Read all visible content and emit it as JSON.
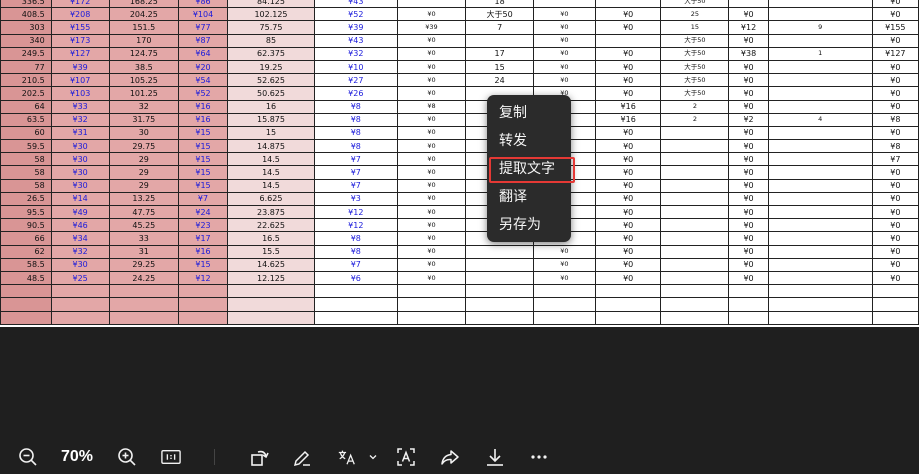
{
  "spreadsheet": {
    "rows": [
      [
        "336.5",
        "¥172",
        "168.25",
        "¥86",
        "84.125",
        "¥43",
        "",
        "18",
        "",
        "",
        "大于50",
        "",
        "",
        "¥0"
      ],
      [
        "408.5",
        "¥208",
        "204.25",
        "¥104",
        "102.125",
        "¥52",
        "¥0",
        "大于50",
        "¥0",
        "¥0",
        "25",
        "¥0",
        "",
        "¥0"
      ],
      [
        "303",
        "¥155",
        "151.5",
        "¥77",
        "75.75",
        "¥39",
        "¥39",
        "7",
        "¥0",
        "¥0",
        "15",
        "¥12",
        "9",
        "¥155"
      ],
      [
        "340",
        "¥173",
        "170",
        "¥87",
        "85",
        "¥43",
        "¥0",
        "",
        "¥0",
        "",
        "大于50",
        "¥0",
        "",
        "¥0"
      ],
      [
        "249.5",
        "¥127",
        "124.75",
        "¥64",
        "62.375",
        "¥32",
        "¥0",
        "17",
        "¥0",
        "¥0",
        "大于50",
        "¥38",
        "1",
        "¥127"
      ],
      [
        "77",
        "¥39",
        "38.5",
        "¥20",
        "19.25",
        "¥10",
        "¥0",
        "15",
        "¥0",
        "¥0",
        "大于50",
        "¥0",
        "",
        "¥0"
      ],
      [
        "210.5",
        "¥107",
        "105.25",
        "¥54",
        "52.625",
        "¥27",
        "¥0",
        "24",
        "¥0",
        "¥0",
        "大于50",
        "¥0",
        "",
        "¥0"
      ],
      [
        "202.5",
        "¥103",
        "101.25",
        "¥52",
        "50.625",
        "¥26",
        "¥0",
        "",
        "¥0",
        "¥0",
        "大于50",
        "¥0",
        "",
        "¥0"
      ],
      [
        "64",
        "¥33",
        "32",
        "¥16",
        "16",
        "¥8",
        "¥8",
        "",
        "",
        "¥16",
        "2",
        "¥0",
        "",
        "¥0"
      ],
      [
        "63.5",
        "¥32",
        "31.75",
        "¥16",
        "15.875",
        "¥8",
        "¥0",
        "",
        "",
        "¥16",
        "2",
        "¥2",
        "4",
        "¥8"
      ],
      [
        "60",
        "¥31",
        "30",
        "¥15",
        "15",
        "¥8",
        "¥0",
        "",
        "",
        "¥0",
        "",
        "¥0",
        "",
        "¥0"
      ],
      [
        "59.5",
        "¥30",
        "29.75",
        "¥15",
        "14.875",
        "¥8",
        "¥0",
        "",
        "",
        "¥0",
        "",
        "¥0",
        "",
        "¥8"
      ],
      [
        "58",
        "¥30",
        "29",
        "¥15",
        "14.5",
        "¥7",
        "¥0",
        "",
        "",
        "¥0",
        "",
        "¥0",
        "",
        "¥7"
      ],
      [
        "58",
        "¥30",
        "29",
        "¥15",
        "14.5",
        "¥7",
        "¥0",
        "",
        "",
        "¥0",
        "",
        "¥0",
        "",
        "¥0"
      ],
      [
        "58",
        "¥30",
        "29",
        "¥15",
        "14.5",
        "¥7",
        "¥0",
        "",
        "",
        "¥0",
        "",
        "¥0",
        "",
        "¥0"
      ],
      [
        "26.5",
        "¥14",
        "13.25",
        "¥7",
        "6.625",
        "¥3",
        "¥0",
        "",
        "",
        "¥0",
        "",
        "¥0",
        "",
        "¥0"
      ],
      [
        "95.5",
        "¥49",
        "47.75",
        "¥24",
        "23.875",
        "¥12",
        "¥0",
        "",
        "",
        "¥0",
        "",
        "¥0",
        "",
        "¥0"
      ],
      [
        "90.5",
        "¥46",
        "45.25",
        "¥23",
        "22.625",
        "¥12",
        "¥0",
        "",
        "",
        "¥0",
        "",
        "¥0",
        "",
        "¥0"
      ],
      [
        "66",
        "¥34",
        "33",
        "¥17",
        "16.5",
        "¥8",
        "¥0",
        "",
        "",
        "¥0",
        "",
        "¥0",
        "",
        "¥0"
      ],
      [
        "62",
        "¥32",
        "31",
        "¥16",
        "15.5",
        "¥8",
        "¥0",
        "",
        "¥0",
        "¥0",
        "",
        "¥0",
        "",
        "¥0"
      ],
      [
        "58.5",
        "¥30",
        "29.25",
        "¥15",
        "14.625",
        "¥7",
        "¥0",
        "",
        "¥0",
        "¥0",
        "",
        "¥0",
        "",
        "¥0"
      ],
      [
        "48.5",
        "¥25",
        "24.25",
        "¥12",
        "12.125",
        "¥6",
        "¥0",
        "",
        "¥0",
        "¥0",
        "",
        "¥0",
        "",
        "¥0"
      ],
      [
        "",
        "",
        "",
        "",
        "",
        "",
        "",
        "",
        "",
        "",
        "",
        "",
        "",
        ""
      ],
      [
        "",
        "",
        "",
        "",
        "",
        "",
        "",
        "",
        "",
        "",
        "",
        "",
        "",
        ""
      ],
      [
        "",
        "",
        "",
        "",
        "",
        "",
        "",
        "",
        "",
        "",
        "",
        "",
        "",
        ""
      ]
    ]
  },
  "context_menu": {
    "items": [
      {
        "label": "复制",
        "name": "ctx-copy"
      },
      {
        "label": "转发",
        "name": "ctx-forward"
      },
      {
        "label": "提取文字",
        "name": "ctx-extract-text",
        "highlighted": true
      },
      {
        "label": "翻译",
        "name": "ctx-translate"
      },
      {
        "label": "另存为",
        "name": "ctx-save-as"
      }
    ],
    "highlight_color": "#e53935"
  },
  "toolbar": {
    "zoom_level": "70%",
    "icons": [
      "zoom-out-icon",
      "zoom-in-icon",
      "actual-size-icon",
      "rotate-icon",
      "edit-icon",
      "translate-icon",
      "chevron-down-icon",
      "ocr-icon",
      "share-icon",
      "download-icon",
      "more-icon"
    ]
  },
  "colors": {
    "viewer_background": "#1f1f1f",
    "menu_background": "#2b2b2b",
    "column_pink_dark": "#d99595",
    "column_pink": "#e3a7a7",
    "column_pink_light": "#f1dada",
    "currency_blue": "#1a1adb"
  }
}
